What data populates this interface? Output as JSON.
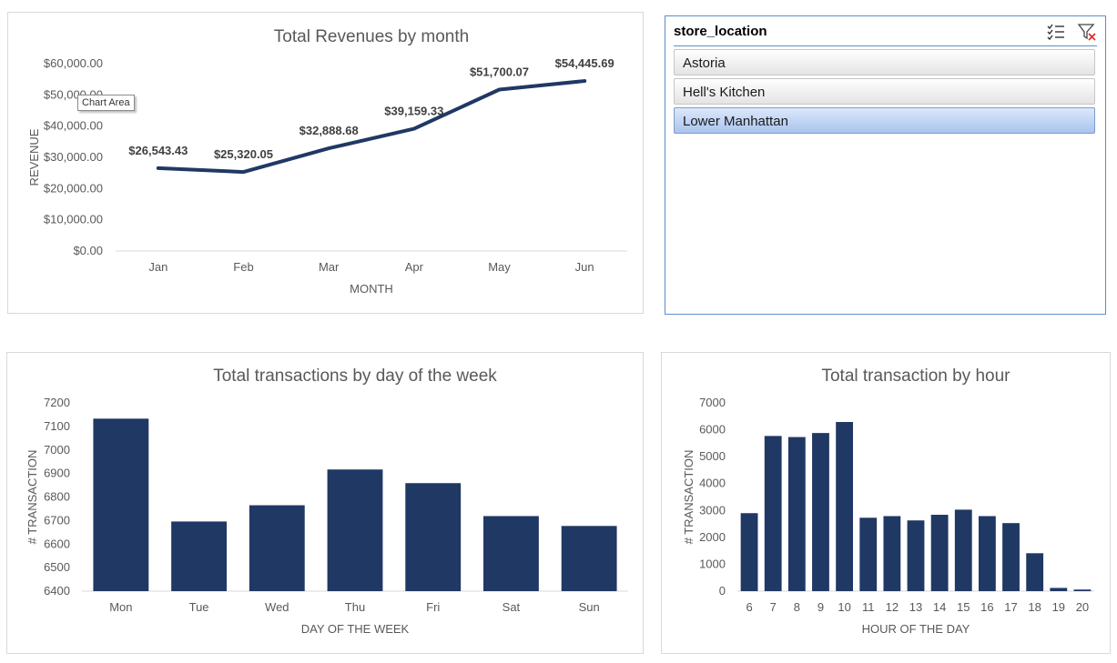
{
  "colors": {
    "series": "#203864",
    "axis_text": "#595959",
    "label_text": "#404040",
    "grid": "#d9d9d9"
  },
  "tooltip": {
    "text": "Chart Area"
  },
  "slicer": {
    "title": "store_location",
    "icons": [
      "multi-select-icon",
      "clear-filter-icon"
    ],
    "items": [
      {
        "label": "Astoria",
        "selected": false
      },
      {
        "label": "Hell's Kitchen",
        "selected": false
      },
      {
        "label": "Lower Manhattan",
        "selected": true
      }
    ]
  },
  "chart_data": [
    {
      "type": "line",
      "title": "Total Revenues by month",
      "xlabel": "MONTH",
      "ylabel": "REVENUE",
      "categories": [
        "Jan",
        "Feb",
        "Mar",
        "Apr",
        "May",
        "Jun"
      ],
      "values": [
        26543.43,
        25320.05,
        32888.68,
        39159.33,
        51700.07,
        54445.69
      ],
      "data_labels": [
        "$26,543.43",
        "$25,320.05",
        "$32,888.68",
        "$39,159.33",
        "$51,700.07",
        "$54,445.69"
      ],
      "ylim": [
        0,
        60000
      ],
      "yticks": [
        0,
        10000,
        20000,
        30000,
        40000,
        50000,
        60000
      ],
      "ytick_labels": [
        "$0.00",
        "$10,000.00",
        "$20,000.00",
        "$30,000.00",
        "$40,000.00",
        "$50,000.00",
        "$60,000.00"
      ],
      "grid": false
    },
    {
      "type": "bar",
      "title": "Total transactions by day of the week",
      "xlabel": "DAY OF THE WEEK",
      "ylabel": "# TRANSACTION",
      "categories": [
        "Mon",
        "Tue",
        "Wed",
        "Thu",
        "Fri",
        "Sat",
        "Sun"
      ],
      "values": [
        7133,
        6696,
        6765,
        6917,
        6859,
        6719,
        6677
      ],
      "ylim": [
        6400,
        7200
      ],
      "yticks": [
        6400,
        6500,
        6600,
        6700,
        6800,
        6900,
        7000,
        7100,
        7200
      ],
      "ytick_labels": [
        "6400",
        "6500",
        "6600",
        "6700",
        "6800",
        "6900",
        "7000",
        "7100",
        "7200"
      ],
      "grid": false
    },
    {
      "type": "bar",
      "title": "Total transaction by hour",
      "xlabel": "HOUR OF THE DAY",
      "ylabel": "# TRANSACTION",
      "categories": [
        "6",
        "7",
        "8",
        "9",
        "10",
        "11",
        "12",
        "13",
        "14",
        "15",
        "16",
        "17",
        "18",
        "19",
        "20"
      ],
      "values": [
        2900,
        5770,
        5730,
        5880,
        6290,
        2730,
        2790,
        2630,
        2840,
        3030,
        2790,
        2530,
        1410,
        120,
        60
      ],
      "ylim": [
        0,
        7000
      ],
      "yticks": [
        0,
        1000,
        2000,
        3000,
        4000,
        5000,
        6000,
        7000
      ],
      "ytick_labels": [
        "0",
        "1000",
        "2000",
        "3000",
        "4000",
        "5000",
        "6000",
        "7000"
      ],
      "grid": false
    }
  ]
}
